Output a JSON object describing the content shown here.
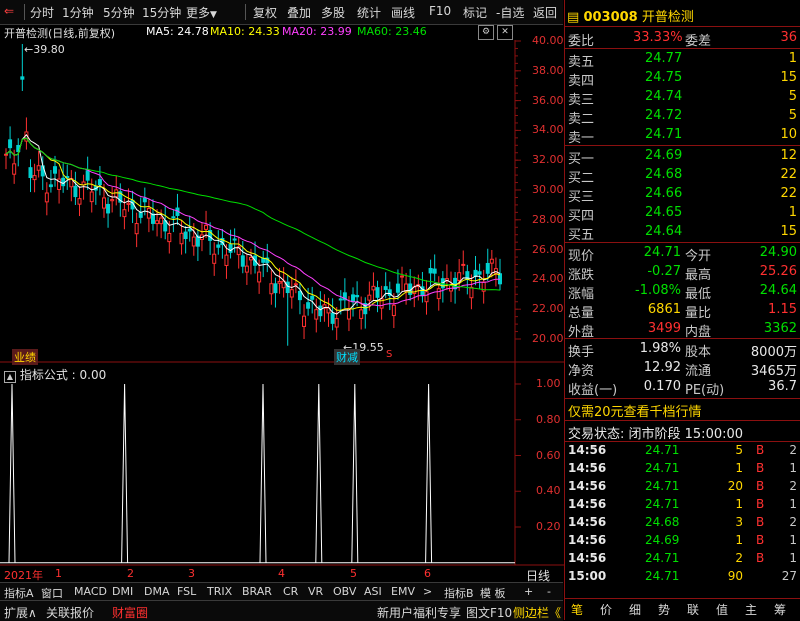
{
  "toolbar": {
    "items": [
      "分时",
      "1分钟",
      "5分钟",
      "15分钟",
      "更多",
      "复权",
      "叠加",
      "多股",
      "统计",
      "画线",
      "F10",
      "标记",
      "-自选",
      "返回"
    ]
  },
  "chart": {
    "title": "开普检测(日线,前复权)",
    "ma": [
      {
        "label": "MA5: 24.78",
        "color": "#ffffff"
      },
      {
        "label": "MA10: 24.33",
        "color": "#ffff00"
      },
      {
        "label": "MA20: 23.99",
        "color": "#ff40ff"
      },
      {
        "label": "MA60: 23.46",
        "color": "#00e000"
      }
    ],
    "price_axis": [
      "40.00",
      "38.00",
      "36.00",
      "34.00",
      "32.00",
      "30.00",
      "28.00",
      "26.00",
      "24.00",
      "22.00",
      "20.00"
    ],
    "high_marker": "39.80",
    "low_marker": "19.55",
    "tag_left": "业绩",
    "tag_mid": "财减",
    "tag_s": "S",
    "indicator_label": "指标公式 : 0.00",
    "indicator_axis": [
      "1.00",
      "0.80",
      "0.60",
      "0.40",
      "0.20"
    ],
    "x_labels": [
      "2021年",
      "1",
      "2",
      "3",
      "4",
      "5",
      "6"
    ],
    "period_label": "日线",
    "chart_data": {
      "type": "candlestick",
      "price_ylim": [
        19.5,
        40.5
      ],
      "high": 39.8,
      "low": 19.55,
      "indicator_ylim": [
        0,
        1.1
      ],
      "indicator_spikes_at_month_fraction": [
        0.0,
        1.8,
        3.7,
        4.4,
        4.9,
        5.9
      ]
    }
  },
  "bottom_tabs": [
    "指标A",
    "窗口",
    "MACD",
    "DMI",
    "DMA",
    "FSL",
    "TRIX",
    "BRAR",
    "CR",
    "VR",
    "OBV",
    "ASI",
    "EMV"
  ],
  "bottom_right": [
    "指标B",
    "模",
    "板",
    "+",
    "-"
  ],
  "status_bar": {
    "left": [
      "扩展∧",
      "关联报价",
      "财富圈"
    ],
    "right": [
      "新用户福利专享",
      "图文F10",
      "侧边栏《"
    ]
  },
  "panel": {
    "code": "003008",
    "name": "开普检测",
    "weibi_label": "委比",
    "weibi": "33.33%",
    "weicha_label": "委差",
    "weicha": "36",
    "asks": [
      {
        "label": "卖五",
        "price": "24.77",
        "vol": "1"
      },
      {
        "label": "卖四",
        "price": "24.75",
        "vol": "15"
      },
      {
        "label": "卖三",
        "price": "24.74",
        "vol": "5"
      },
      {
        "label": "卖二",
        "price": "24.72",
        "vol": "5"
      },
      {
        "label": "卖一",
        "price": "24.71",
        "vol": "10"
      }
    ],
    "bids": [
      {
        "label": "买一",
        "price": "24.69",
        "vol": "12"
      },
      {
        "label": "买二",
        "price": "24.68",
        "vol": "22"
      },
      {
        "label": "买三",
        "price": "24.66",
        "vol": "22"
      },
      {
        "label": "买四",
        "price": "24.65",
        "vol": "1"
      },
      {
        "label": "买五",
        "price": "24.64",
        "vol": "15"
      }
    ],
    "stats": [
      {
        "l1": "现价",
        "v1": "24.71",
        "c1": "g",
        "l2": "今开",
        "v2": "24.90",
        "c2": "g"
      },
      {
        "l1": "涨跌",
        "v1": "-0.27",
        "c1": "g",
        "l2": "最高",
        "v2": "25.26",
        "c2": "r"
      },
      {
        "l1": "涨幅",
        "v1": "-1.08%",
        "c1": "g",
        "l2": "最低",
        "v2": "24.64",
        "c2": "g"
      },
      {
        "l1": "总量",
        "v1": "6861",
        "c1": "y",
        "l2": "量比",
        "v2": "1.15",
        "c2": "r"
      },
      {
        "l1": "外盘",
        "v1": "3499",
        "c1": "r",
        "l2": "内盘",
        "v2": "3362",
        "c2": "g"
      }
    ],
    "stats2": [
      {
        "l1": "换手",
        "v1": "1.98%",
        "l2": "股本",
        "v2": "8000万"
      },
      {
        "l1": "净资",
        "v1": "12.92",
        "l2": "流通",
        "v2": "3465万"
      },
      {
        "l1": "收益(一)",
        "v1": "0.170",
        "l2": "PE(动)",
        "v2": "36.7"
      }
    ],
    "promo": "仅需20元查看千档行情",
    "trade_status": "交易状态: 闭市阶段 15:00:00",
    "ticks": [
      {
        "t": "14:56",
        "p": "24.71",
        "v": "5",
        "s": "B",
        "n": "2"
      },
      {
        "t": "14:56",
        "p": "24.71",
        "v": "1",
        "s": "B",
        "n": "1"
      },
      {
        "t": "14:56",
        "p": "24.71",
        "v": "20",
        "s": "B",
        "n": "2"
      },
      {
        "t": "14:56",
        "p": "24.71",
        "v": "1",
        "s": "B",
        "n": "1"
      },
      {
        "t": "14:56",
        "p": "24.68",
        "v": "3",
        "s": "B",
        "n": "2"
      },
      {
        "t": "14:56",
        "p": "24.69",
        "v": "1",
        "s": "B",
        "n": "1"
      },
      {
        "t": "14:56",
        "p": "24.71",
        "v": "2",
        "s": "B",
        "n": "1"
      },
      {
        "t": "15:00",
        "p": "24.71",
        "v": "90",
        "s": "",
        "n": "27"
      }
    ],
    "bottom_tabs": [
      "笔",
      "价",
      "细",
      "势",
      "联",
      "值",
      "主",
      "筹"
    ]
  }
}
